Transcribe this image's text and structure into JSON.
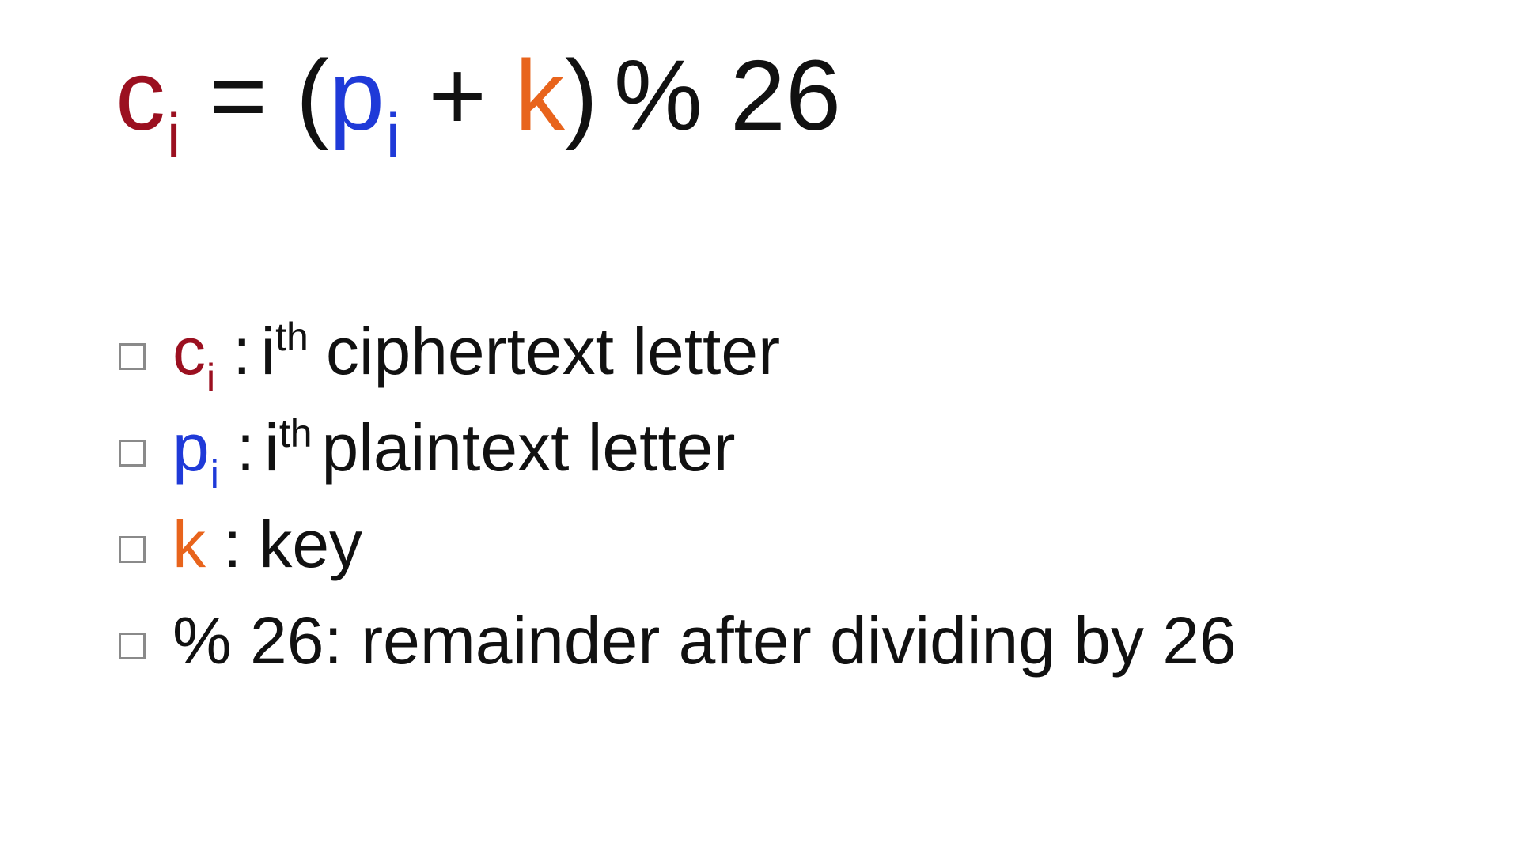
{
  "colors": {
    "cipher": "#9b1020",
    "plain": "#1f3ad8",
    "key": "#e8641c",
    "text": "#111111",
    "checkbox_border": "#8a8a8a"
  },
  "formula": {
    "c": "c",
    "c_sub": "i",
    "equals": "=",
    "open_paren": "(",
    "p": "p",
    "p_sub": "i",
    "plus": "+",
    "k": "k",
    "close_paren": ")",
    "mod": "% 26"
  },
  "bullets": [
    {
      "symbol": "c",
      "symbol_sub": "i",
      "sep": ":",
      "ordinal_base": "i",
      "ordinal_sup": "th",
      "text": "ciphertext letter"
    },
    {
      "symbol": "p",
      "symbol_sub": "i",
      "sep": ":",
      "ordinal_base": "i",
      "ordinal_sup": "th",
      "text": "plaintext letter"
    },
    {
      "symbol": "k",
      "sep": ":",
      "text": "key"
    },
    {
      "text": "% 26: remainder after dividing by 26"
    }
  ]
}
